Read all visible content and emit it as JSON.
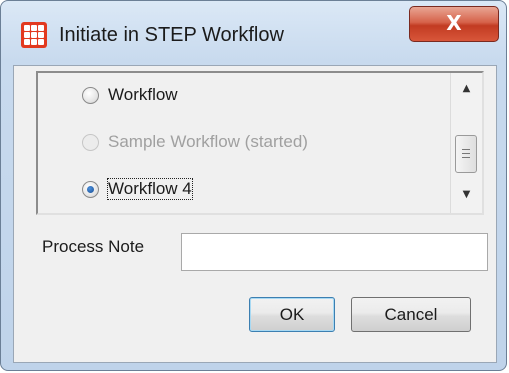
{
  "window": {
    "title": "Initiate in STEP Workflow",
    "app_icon": "step-grid-icon",
    "close_label": "X"
  },
  "workflows": {
    "options": [
      {
        "label": "Workflow",
        "checked": false,
        "disabled": false
      },
      {
        "label": "Sample Workflow (started)",
        "checked": false,
        "disabled": true
      },
      {
        "label": "Workflow 4",
        "checked": true,
        "disabled": false
      }
    ],
    "scroll_up_icon": "▲",
    "scroll_down_icon": "▼"
  },
  "process_note": {
    "label": "Process Note",
    "value": ""
  },
  "buttons": {
    "ok_label": "OK",
    "cancel_label": "Cancel"
  },
  "colors": {
    "app_icon": "#e2391f",
    "close_button": "#c23b22",
    "default_button_border": "#3c7fb1"
  }
}
